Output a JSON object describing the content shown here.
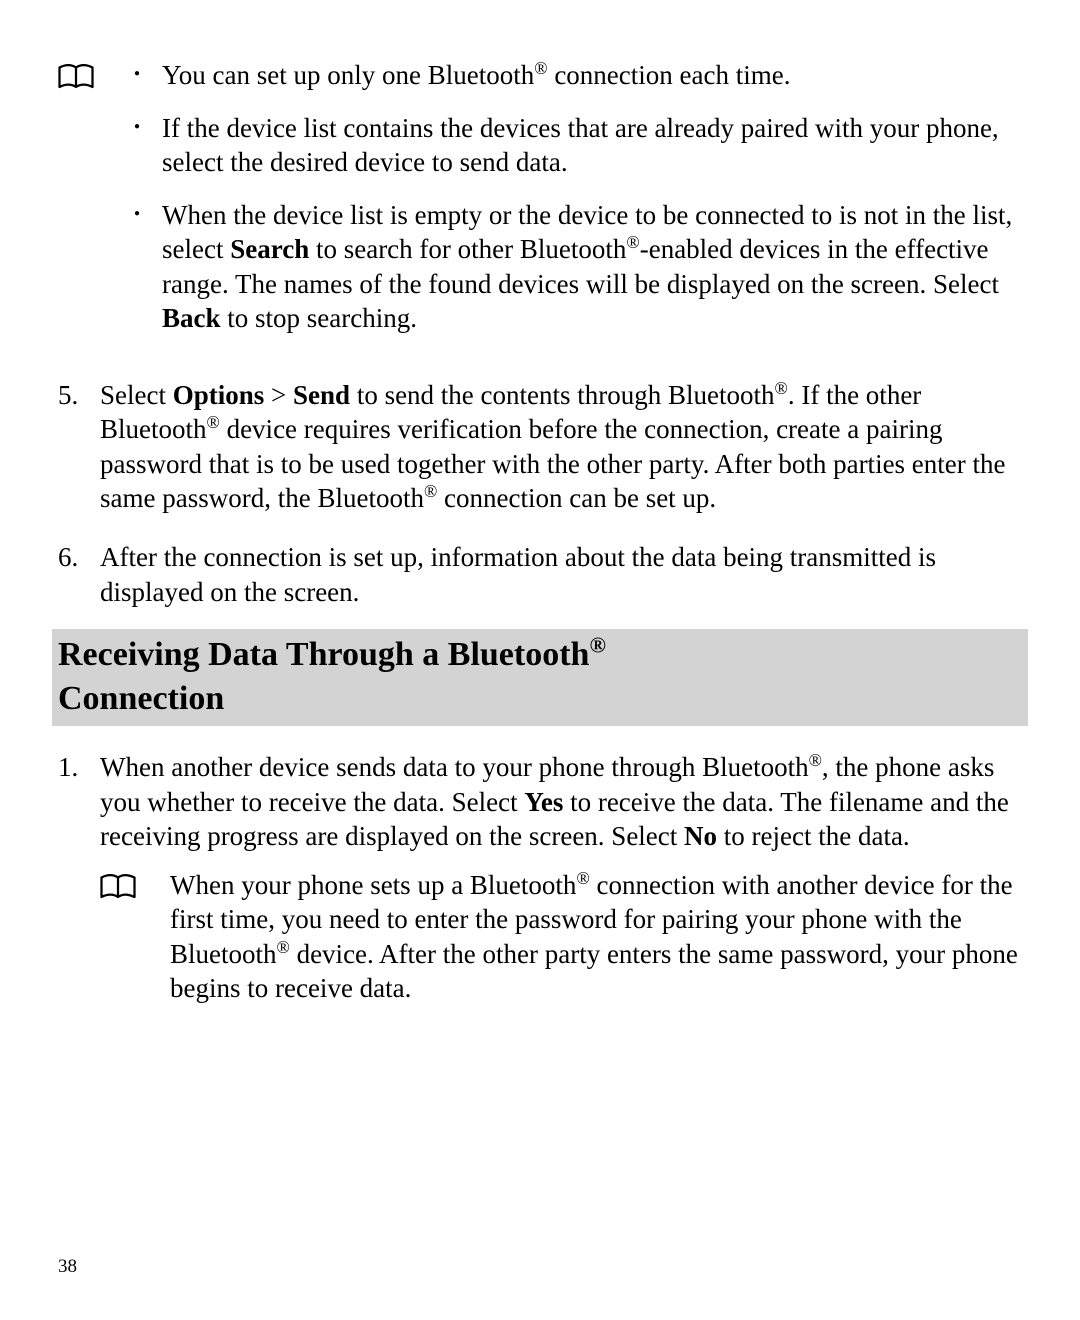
{
  "noteA": {
    "bul1_a": "You can set up only one Bluetooth",
    "bul1_b": " connection each time.",
    "bul2": "If the device list contains the devices that are already paired with your phone, select the desired device to send data.",
    "bul3_a": "When the device list is empty or the device to be connected to is not in the list, select ",
    "bul3_search": "Search",
    "bul3_b": " to search for other Bluetooth",
    "bul3_c": "-enabled devices in the effective range. The names of the found devices will be displayed on the screen. Select ",
    "bul3_back": "Back",
    "bul3_d": " to stop searching."
  },
  "step5": {
    "num": "5.",
    "a": "Select ",
    "options": "Options",
    "gt": " > ",
    "send": "Send",
    "b": " to send the contents through Bluetooth",
    "c": ". If the other Bluetooth",
    "d": " device requires verification before the connection, create a pairing password that is to be used together with the other party. After both parties enter the same password, the Bluetooth",
    "e": " connection can be set up."
  },
  "step6": {
    "num": "6.",
    "text": "After the connection is set up, information about the data being transmitted is displayed on the screen."
  },
  "heading": {
    "line1_a": "Receiving Data Through a Bluetooth",
    "line2": "Connection"
  },
  "recv1": {
    "num": "1.",
    "a": "When another device sends data to your phone through Bluetooth",
    "b": ", the phone asks you whether to receive the data. Select ",
    "yes": "Yes",
    "c": " to receive the data. The filename and the receiving progress are displayed on the screen. Select ",
    "no": "No",
    "d": " to reject the data."
  },
  "noteB": {
    "a": "When your phone sets up a Bluetooth",
    "b": " connection with another device for the first time, you need to enter the password for pairing your phone with the Bluetooth",
    "c": " device. After the other party enters the same password, your phone begins to receive data."
  },
  "reg": "®",
  "pageNumber": "38"
}
